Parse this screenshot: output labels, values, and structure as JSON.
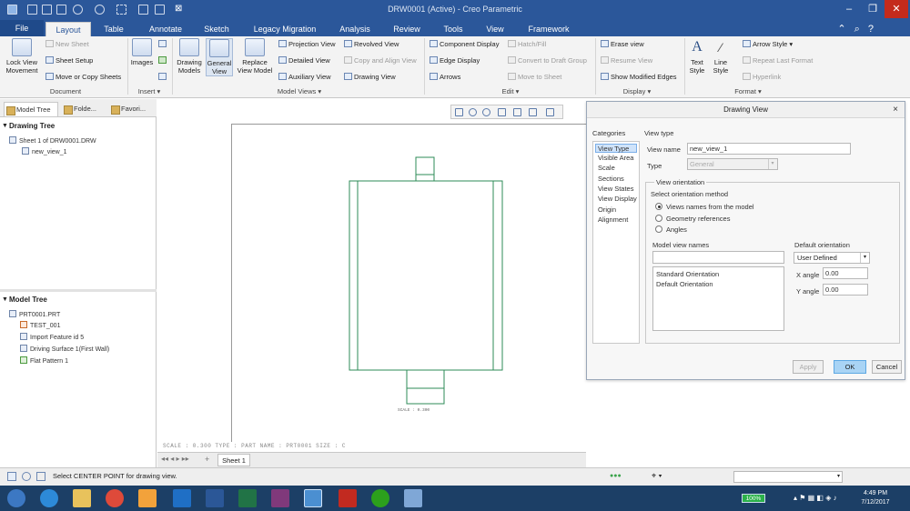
{
  "window": {
    "title": "DRW0001 (Active) - Creo Parametric",
    "controls": [
      "–",
      "❐",
      "✕"
    ]
  },
  "menu_tabs": [
    "File",
    "Layout",
    "Table",
    "Annotate",
    "Sketch",
    "Legacy Migration",
    "Analysis",
    "Review",
    "Tools",
    "View",
    "Framework"
  ],
  "active_tab": "Layout",
  "ribbon": {
    "document": {
      "group_label": "Document",
      "lock_view_movement": "Lock View Movement",
      "new_sheet": "New Sheet",
      "sheet_setup": "Sheet Setup",
      "move_copy_sheets": "Move or Copy Sheets"
    },
    "insert": {
      "group_label": "Insert ▾",
      "images": "Images"
    },
    "model_views": {
      "group_label": "Model Views ▾",
      "drawing_models": "Drawing Models",
      "general_view": "General View",
      "replace_view_model": "Replace View Model",
      "projection_view": "Projection View",
      "detailed_view": "Detailed View",
      "auxiliary_view": "Auxiliary View",
      "revolved_view": "Revolved View",
      "copy_align_view": "Copy and Align View",
      "drawing_view": "Drawing View"
    },
    "edit": {
      "group_label": "Edit ▾",
      "component_display": "Component Display",
      "edge_display": "Edge Display",
      "arrows": "Arrows",
      "hatch_fill": "Hatch/Fill",
      "convert_draft_group": "Convert to Draft Group",
      "move_to_sheet": "Move to Sheet"
    },
    "display": {
      "group_label": "Display ▾",
      "erase_view": "Erase view",
      "resume_view": "Resume View",
      "show_modified_edges": "Show Modified Edges"
    },
    "format": {
      "group_label": "Format ▾",
      "text_style": "Text Style",
      "line_style": "Line Style",
      "arrow_style": "Arrow Style",
      "repeat_last_format": "Repeat Last Format",
      "hyperlink": "Hyperlink"
    }
  },
  "left_panel": {
    "tabs": [
      "Model Tree",
      "Folde...",
      "Favori..."
    ],
    "drawing_tree_title": "Drawing Tree",
    "drawing_tree_items": [
      "Sheet 1 of DRW0001.DRW",
      "new_view_1"
    ],
    "model_tree_title": "Model Tree",
    "model_tree_items": [
      "PRT0001.PRT",
      "TEST_001",
      "Import Feature id 5",
      "Driving Surface 1(First Wall)",
      "Flat Pattern 1"
    ]
  },
  "graphics": {
    "scale_label": "SCALE : 0.300",
    "sheet_info": "SCALE : 0.300    TYPE : PART    NAME : PRT0001    SIZE : C",
    "sheet_tab": "Sheet 1",
    "line_color": "#2e8b57"
  },
  "dialog": {
    "title": "Drawing View",
    "categories_label": "Categories",
    "categories": [
      "View Type",
      "Visible Area",
      "Scale",
      "Sections",
      "View States",
      "View Display",
      "Origin",
      "Alignment"
    ],
    "selected_category": "View Type",
    "section_title": "View type",
    "view_name_label": "View name",
    "view_name_value": "new_view_1",
    "type_label": "Type",
    "type_value": "General",
    "view_orientation_label": "View orientation",
    "select_method_label": "Select orientation method",
    "methods": [
      "Views names from the model",
      "Geometry references",
      "Angles"
    ],
    "selected_method": "Views names from the model",
    "model_view_names_label": "Model view names",
    "model_view_names": [
      "Standard Orientation",
      "Default Orientation"
    ],
    "default_orientation_label": "Default orientation",
    "default_orientation_value": "User Defined",
    "x_angle_label": "X angle",
    "x_angle_value": "0.00",
    "y_angle_label": "Y angle",
    "y_angle_value": "0.00",
    "buttons": {
      "apply": "Apply",
      "ok": "OK",
      "cancel": "Cancel"
    }
  },
  "status": {
    "message": "Select CENTER POINT for drawing view."
  },
  "taskbar": {
    "battery": "100%",
    "time": "4:49 PM",
    "date": "7/12/2017"
  }
}
